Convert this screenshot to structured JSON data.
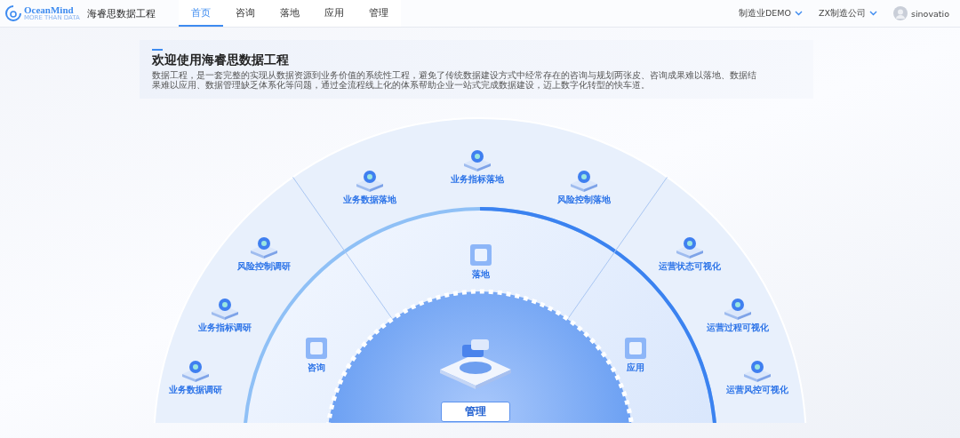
{
  "header": {
    "logo": {
      "name": "OceanMind",
      "tagline": "MORE THAN DATA"
    },
    "app_title": "海睿思数据工程",
    "tabs": [
      {
        "label": "首页",
        "selected": true
      },
      {
        "label": "咨询",
        "selected": false
      },
      {
        "label": "落地",
        "selected": false
      },
      {
        "label": "应用",
        "selected": false
      },
      {
        "label": "管理",
        "selected": false
      }
    ],
    "org_select": {
      "value": "制造业DEMO"
    },
    "company_select": {
      "value": "ZX制造公司"
    },
    "user": {
      "name": "sinovatio"
    }
  },
  "welcome": {
    "title": "欢迎使用海睿思数据工程",
    "description": "数据工程，是一套完整的实现从数据资源到业务价值的系统性工程，避免了传统数据建设方式中经常存在的咨询与规划两张皮、咨询成果难以落地、数据结果难以应用、数据管理缺乏体系化等问题，通过全流程线上化的体系帮助企业一站式完成数据建设，迈上数字化转型的快车道。"
  },
  "diagram": {
    "center": {
      "label": "管理"
    },
    "middle_nodes": [
      {
        "label": "落地"
      },
      {
        "label": "咨询"
      },
      {
        "label": "应用"
      }
    ],
    "outer_nodes": [
      {
        "label": "业务指标落地"
      },
      {
        "label": "业务数据落地"
      },
      {
        "label": "风险控制落地"
      },
      {
        "label": "风险控制调研"
      },
      {
        "label": "业务指标调研"
      },
      {
        "label": "业务数据调研"
      },
      {
        "label": "运营状态可视化"
      },
      {
        "label": "运营过程可视化"
      },
      {
        "label": "运营风控可视化"
      }
    ]
  }
}
